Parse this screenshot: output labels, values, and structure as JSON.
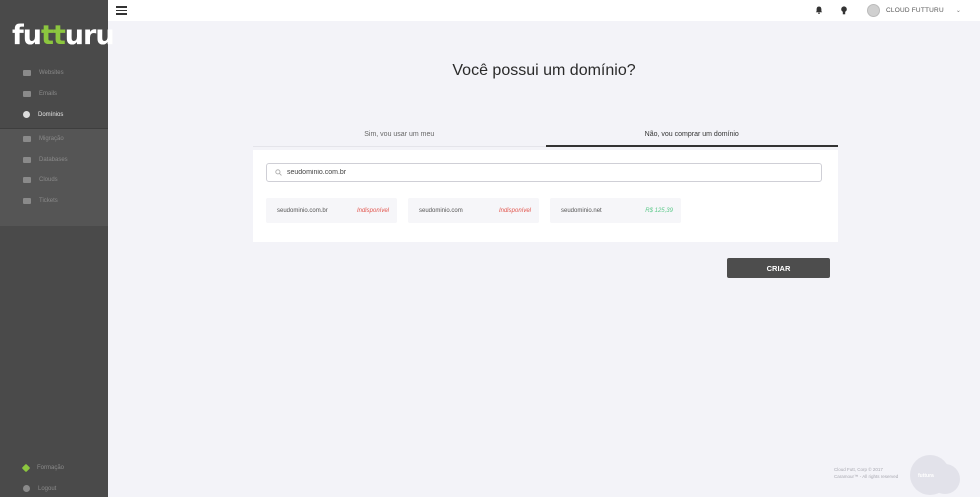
{
  "brand": {
    "logo_pre": "fu",
    "logo_mid": "tt",
    "logo_post": "uru",
    "accent": "#8cc63f"
  },
  "sidebar": {
    "items": [
      {
        "label": "Websites",
        "icon": "website-icon"
      },
      {
        "label": "Emails",
        "icon": "email-icon"
      },
      {
        "label": "Domínios",
        "icon": "globe-icon",
        "active": true
      }
    ],
    "sub_items": [
      {
        "label": "Migração",
        "icon": "swap-icon"
      },
      {
        "label": "Databases",
        "icon": "database-icon"
      },
      {
        "label": "Clouds",
        "icon": "cloud-icon"
      },
      {
        "label": "Tickets",
        "icon": "chat-icon"
      }
    ],
    "bottom": [
      {
        "label": "Formação",
        "icon": "diamond-icon"
      },
      {
        "label": "Logout",
        "icon": "power-icon"
      }
    ]
  },
  "topbar": {
    "user_name": "CLOUD FUTTURU"
  },
  "main": {
    "title": "Você possui um domínio?",
    "tabs": [
      {
        "label": "Sim, vou usar um meu",
        "active": false
      },
      {
        "label": "Não, vou comprar um domínio",
        "active": true
      }
    ],
    "search_value": "seudominio.com.br",
    "results": [
      {
        "domain": "seudominio.com.br",
        "status": "Indisponível",
        "available": false
      },
      {
        "domain": "seudominio.com",
        "status": "Indisponível",
        "available": false
      },
      {
        "domain": "seudominio.net",
        "status": "R$ 125,39",
        "available": true
      }
    ],
    "create_label": "CRIAR"
  },
  "footer": {
    "line1": "Cloud Futt, Corp © 2017",
    "line2": "Caramour™ - All rights reserved",
    "badge": "futtura"
  },
  "colors": {
    "unavailable": "#e2554d",
    "available": "#5cc98a",
    "sidebar": "#4a4a4a"
  }
}
